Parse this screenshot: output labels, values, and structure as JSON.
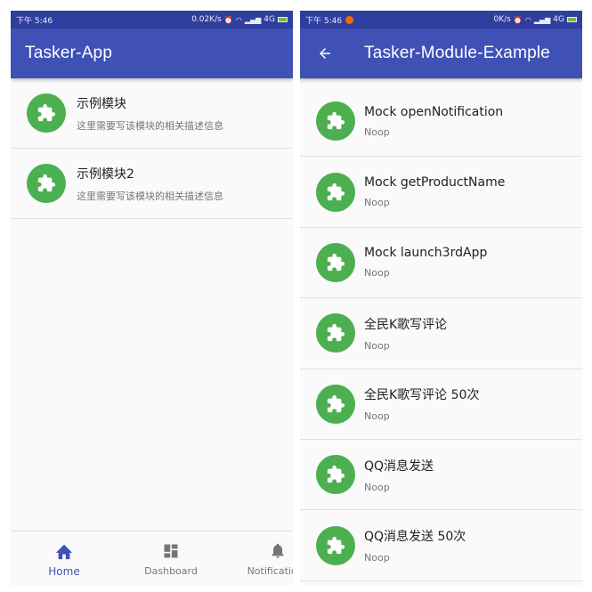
{
  "left_phone": {
    "status": {
      "time": "下午 5:46",
      "speed": "0.02K/s",
      "network": "4G"
    },
    "appbar": {
      "title": "Tasker-App"
    },
    "modules": [
      {
        "title": "示例模块",
        "subtitle": "这里需要写该模块的相关描述信息",
        "icon": "puzzle-icon"
      },
      {
        "title": "示例模块2",
        "subtitle": "这里需要写该模块的相关描述信息",
        "icon": "puzzle-icon"
      }
    ],
    "bottom_nav": [
      {
        "label": "Home",
        "icon": "home-icon",
        "active": true
      },
      {
        "label": "Dashboard",
        "icon": "dashboard-icon",
        "active": false
      },
      {
        "label": "Notifications",
        "icon": "bell-icon",
        "active": false
      }
    ]
  },
  "right_phone": {
    "status": {
      "time": "下午 5:46",
      "speed": "0K/s",
      "network": "4G"
    },
    "appbar": {
      "title": "Tasker-Module-Example",
      "back_icon": "arrow-back-icon"
    },
    "tasks": [
      {
        "title": "Mock openNotification",
        "subtitle": "Noop"
      },
      {
        "title": "Mock getProductName",
        "subtitle": "Noop"
      },
      {
        "title": "Mock launch3rdApp",
        "subtitle": "Noop"
      },
      {
        "title": "全民K歌写评论",
        "subtitle": "Noop"
      },
      {
        "title": "全民K歌写评论 50次",
        "subtitle": "Noop"
      },
      {
        "title": "QQ消息发送",
        "subtitle": "Noop"
      },
      {
        "title": "QQ消息发送 50次",
        "subtitle": "Noop"
      }
    ]
  },
  "colors": {
    "primary": "#3f51b5",
    "primary_dark": "#303f9f",
    "icon_bg": "#4caf50",
    "background": "#fafafa"
  }
}
